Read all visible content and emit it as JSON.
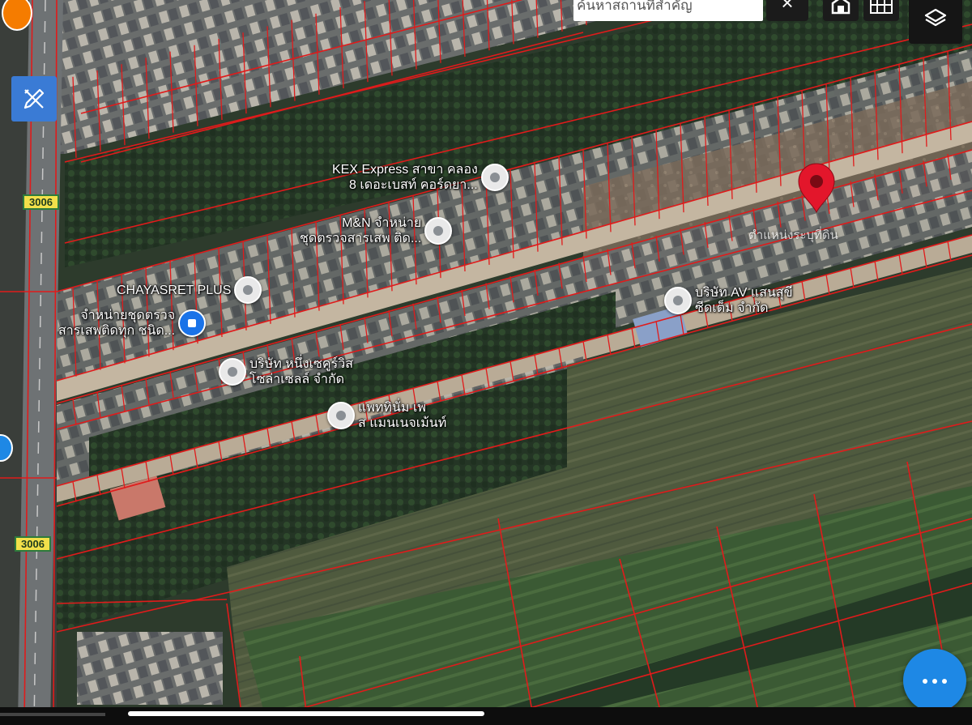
{
  "search": {
    "placeholder": "ค้นหาสถานที่สำคัญ"
  },
  "toolbar": {
    "close_label": "×"
  },
  "road_badges": [
    "3006",
    "3006"
  ],
  "pois": [
    {
      "name": "kex",
      "label": "KEX Express สาขา คลอง\n8 เดอะเบสท์ คอร์ดยา..."
    },
    {
      "name": "mn",
      "label": "M&N จำหน่าย\nชุดตรวจสารเสพ ติด..."
    },
    {
      "name": "chayasret",
      "label": "CHAYASRET PLUS"
    },
    {
      "name": "drug-test",
      "label": "จำหน่ายชุดตรวจ\nสารเสพติดทุก ชนิด..."
    },
    {
      "name": "av",
      "label": "บริษัท AV แสนสุขี\nซีดเต็ม จำกัด"
    },
    {
      "name": "nueng",
      "label": "บริษัท หนึ่งเซคูร์วิส\nโซล่าเซลล์ จำกัด"
    },
    {
      "name": "patinum",
      "label": "แพททินั่ม เพ\nส แมนเนจเม้นท์"
    }
  ],
  "marker": {
    "label": "ตำแหน่งระบุที่ดิน"
  },
  "colors": {
    "parcel_line": "#e01b1b",
    "marker": "#e3162b",
    "fab": "#1e88e5",
    "tools": "#3a7bd5"
  },
  "icons": [
    "pencil-ruler-icon",
    "layers-icon",
    "grid-icon",
    "home-map-icon",
    "more-dots-icon",
    "location-pin-icon"
  ]
}
